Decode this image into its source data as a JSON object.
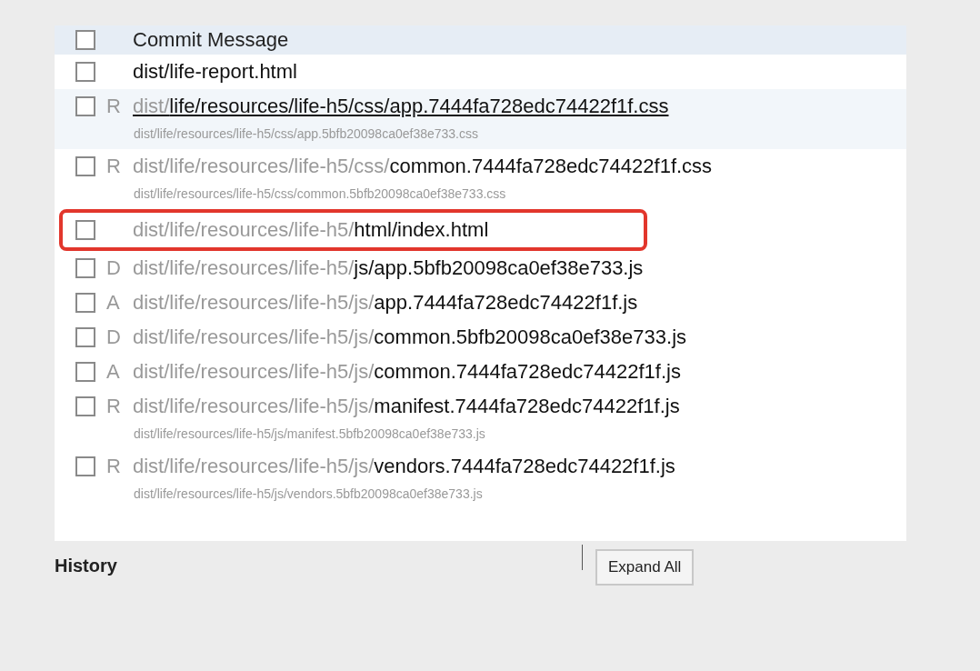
{
  "commit_row": {
    "label": "Commit Message",
    "checked": false
  },
  "files": [
    {
      "name": "dist/life-report.html",
      "checked": false,
      "selected": false,
      "annotated": false
    },
    {
      "status": "R",
      "dir": "dist/",
      "name": "life/resources/life-h5/css/app.7444fa728edc74422f1f.css",
      "old_path": "dist/life/resources/life-h5/css/app.5bfb20098ca0ef38e733.css",
      "checked": false,
      "selected": true,
      "annotated": false
    },
    {
      "status": "R",
      "dir": "dist/life/resources/life-h5/css/",
      "name": "common.7444fa728edc74422f1f.css",
      "old_path": "dist/life/resources/life-h5/css/common.5bfb20098ca0ef38e733.css",
      "checked": false,
      "selected": false,
      "annotated": false
    },
    {
      "dir": "dist/life/resources/life-h5/",
      "name": "html/index.html",
      "checked": false,
      "selected": false,
      "annotated": true
    },
    {
      "status": "D",
      "dir": "dist/life/resources/life-h5/",
      "name": "js/app.5bfb20098ca0ef38e733.js",
      "checked": false,
      "selected": false,
      "annotated": false
    },
    {
      "status": "A",
      "dir": "dist/life/resources/life-h5/js/",
      "name": "app.7444fa728edc74422f1f.js",
      "checked": false,
      "selected": false,
      "annotated": false
    },
    {
      "status": "D",
      "dir": "dist/life/resources/life-h5/js/",
      "name": "common.5bfb20098ca0ef38e733.js",
      "checked": false,
      "selected": false,
      "annotated": false
    },
    {
      "status": "A",
      "dir": "dist/life/resources/life-h5/js/",
      "name": "common.7444fa728edc74422f1f.js",
      "checked": false,
      "selected": false,
      "annotated": false
    },
    {
      "status": "R",
      "dir": "dist/life/resources/life-h5/js/",
      "name": "manifest.7444fa728edc74422f1f.js",
      "old_path": "dist/life/resources/life-h5/js/manifest.5bfb20098ca0ef38e733.js",
      "checked": false,
      "selected": false,
      "annotated": false
    },
    {
      "status": "R",
      "dir": "dist/life/resources/life-h5/js/",
      "name": "vendors.7444fa728edc74422f1f.js",
      "old_path": "dist/life/resources/life-h5/js/vendors.5bfb20098ca0ef38e733.js",
      "checked": false,
      "selected": false,
      "annotated": false
    }
  ],
  "history": {
    "label": "History"
  },
  "expand_button": {
    "label": "Expand All"
  }
}
